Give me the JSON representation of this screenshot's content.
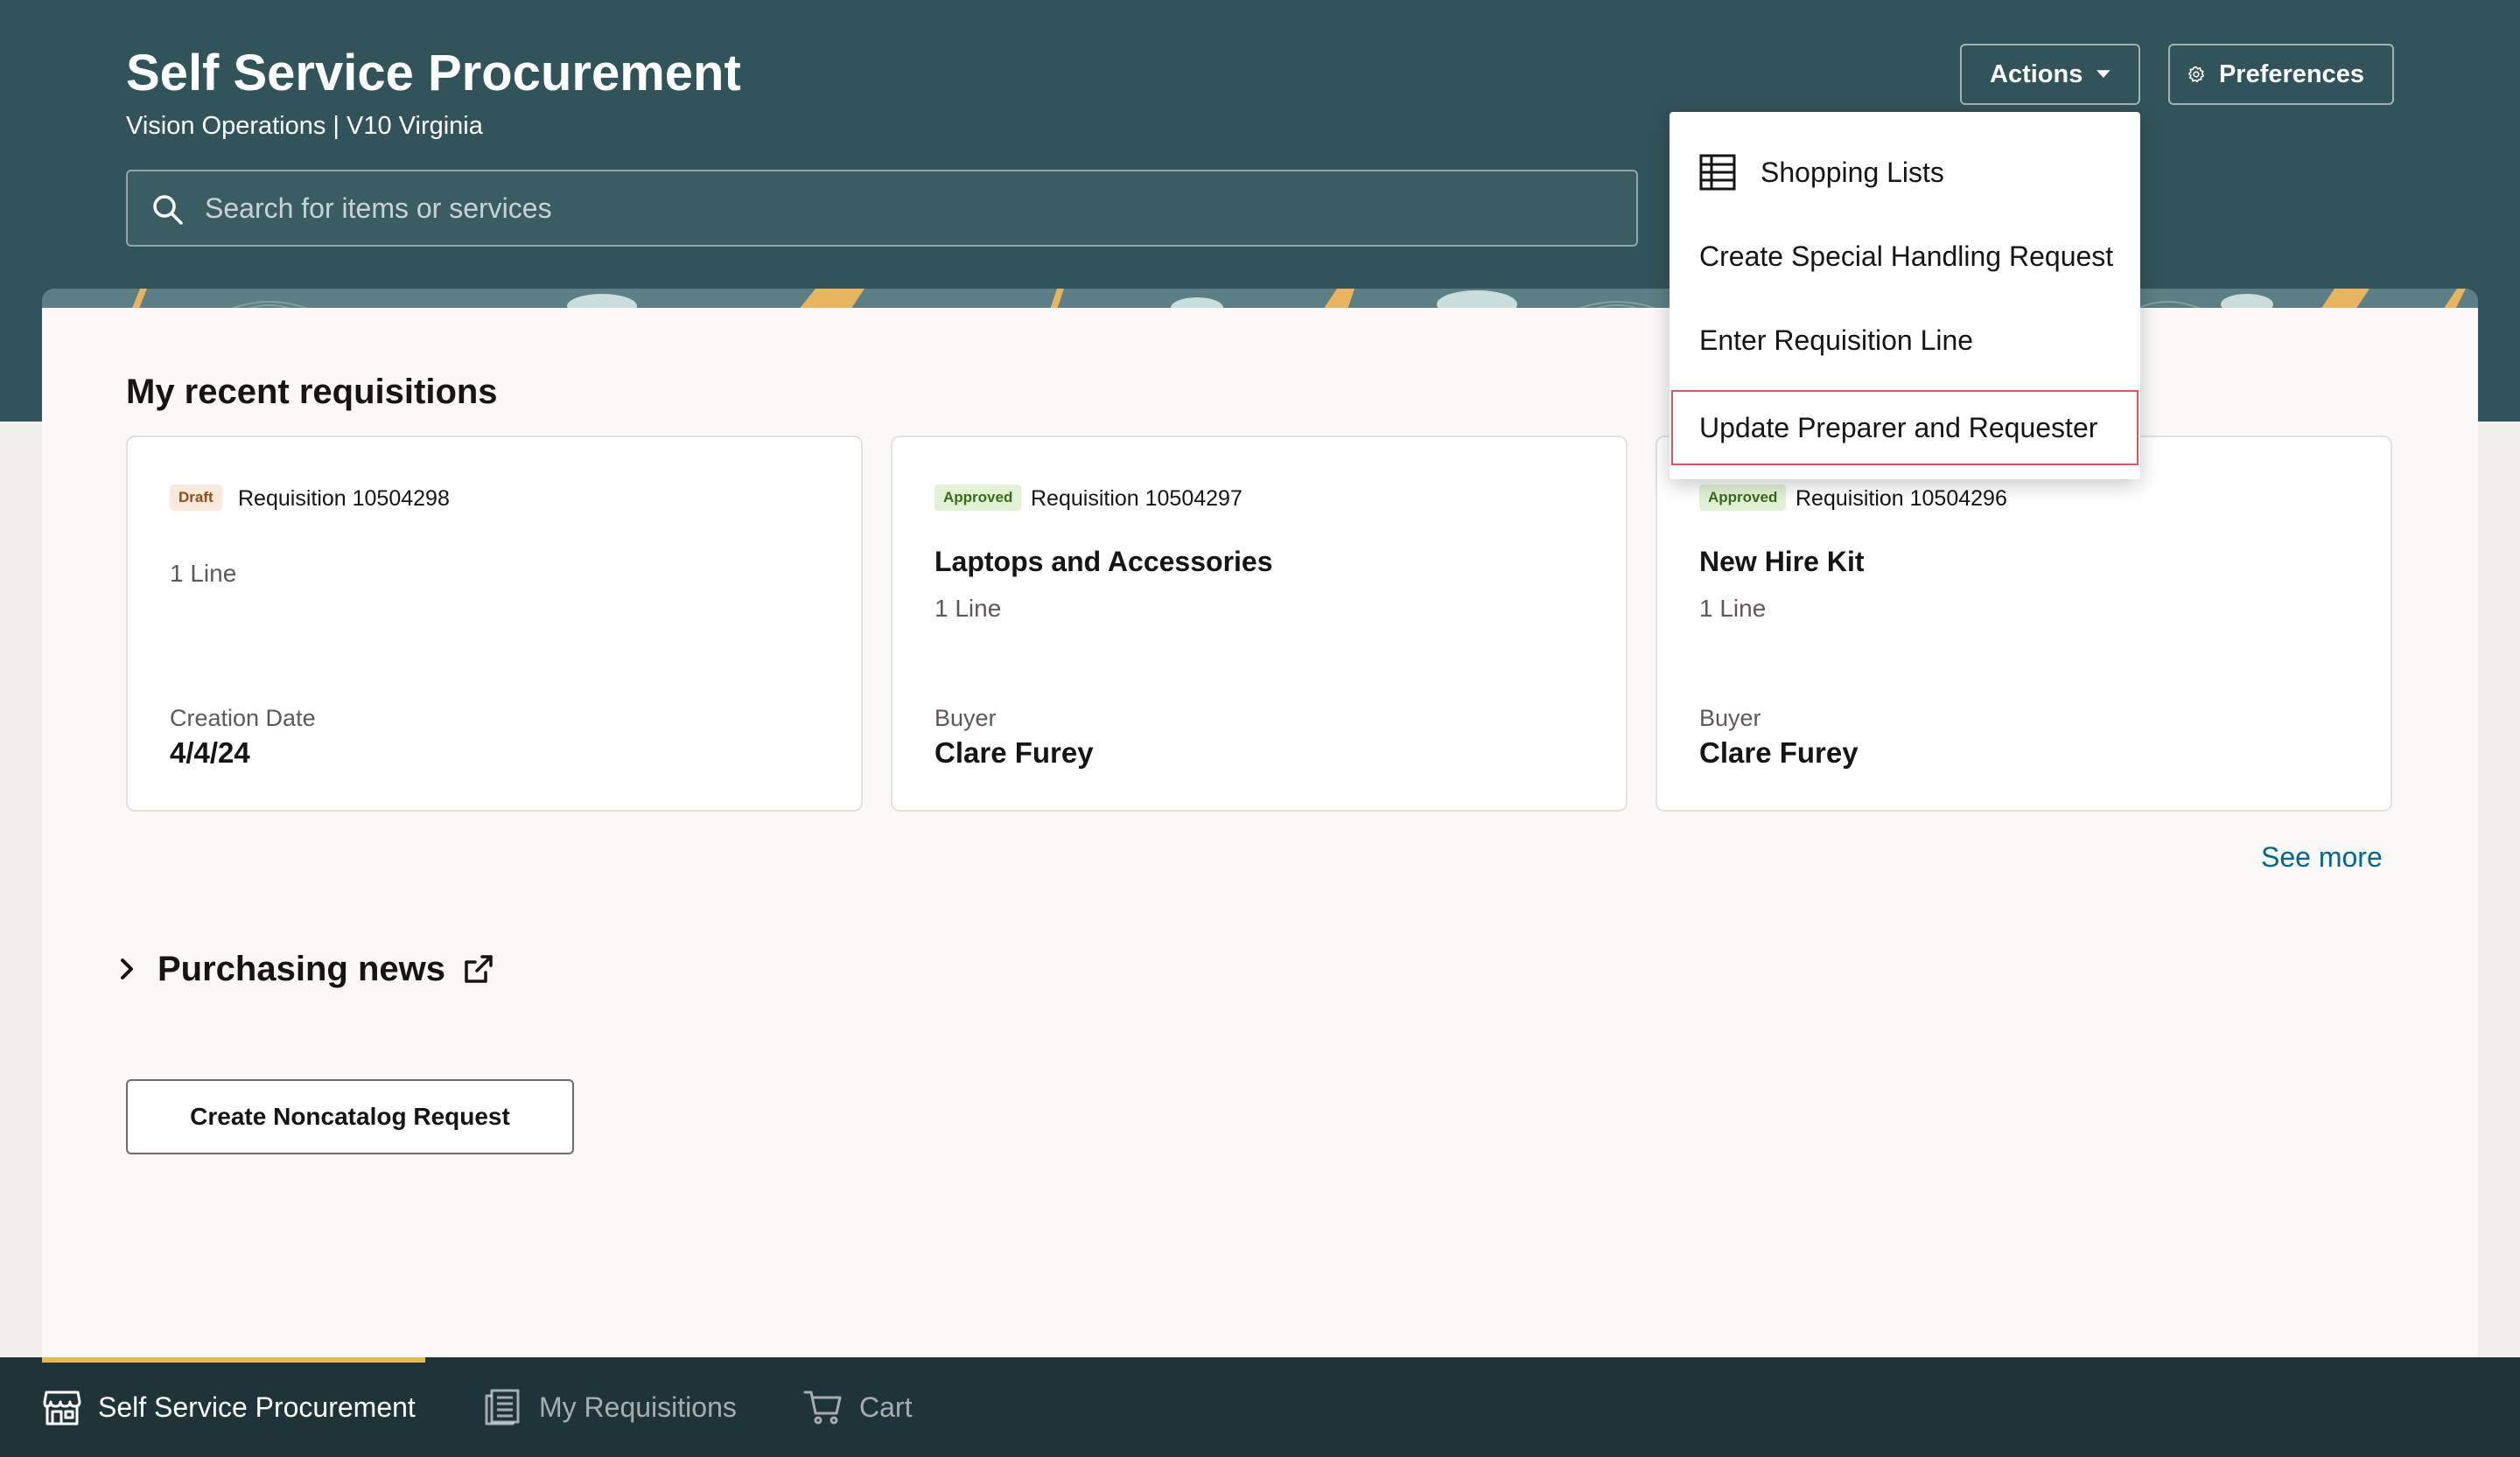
{
  "header": {
    "title": "Self Service Procurement",
    "subtitle": "Vision Operations | V10 Virginia",
    "search_placeholder": "Search for items or services",
    "actions_label": "Actions",
    "preferences_label": "Preferences"
  },
  "actions_menu": {
    "items": [
      {
        "label": "Shopping Lists",
        "icon": "table-grid-icon"
      },
      {
        "label": "Create Special Handling Request"
      },
      {
        "label": "Enter Requisition Line"
      },
      {
        "label": "Update Preparer and Requester",
        "focused": true
      }
    ]
  },
  "recent": {
    "title": "My recent requisitions",
    "cards": [
      {
        "status": "Draft",
        "number": "Requisition 10504298",
        "name": "",
        "lines": "1 Line",
        "meta_label": "Creation Date",
        "meta_value": "4/4/24"
      },
      {
        "status": "Approved",
        "number": "Requisition 10504297",
        "name": "Laptops and Accessories",
        "lines": "1 Line",
        "meta_label": "Buyer",
        "meta_value": "Clare Furey"
      },
      {
        "status": "Approved",
        "number": "Requisition 10504296",
        "name": "New Hire Kit",
        "lines": "1 Line",
        "meta_label": "Buyer",
        "meta_value": "Clare Furey"
      }
    ],
    "see_more": "See more"
  },
  "news": {
    "title": "Purchasing news"
  },
  "noncatalog_label": "Create Noncatalog Request",
  "bottom_nav": {
    "items": [
      {
        "label": "Self Service Procurement",
        "icon": "storefront-icon",
        "active": true
      },
      {
        "label": "My Requisitions",
        "icon": "requisitions-icon"
      },
      {
        "label": "Cart",
        "icon": "cart-icon"
      }
    ]
  },
  "colors": {
    "header_bg": "#31535a",
    "nav_bg": "#1f3438",
    "accent_link": "#00688c",
    "nav_indicator": "#e6b84e",
    "focus_outline": "#e0545c"
  }
}
